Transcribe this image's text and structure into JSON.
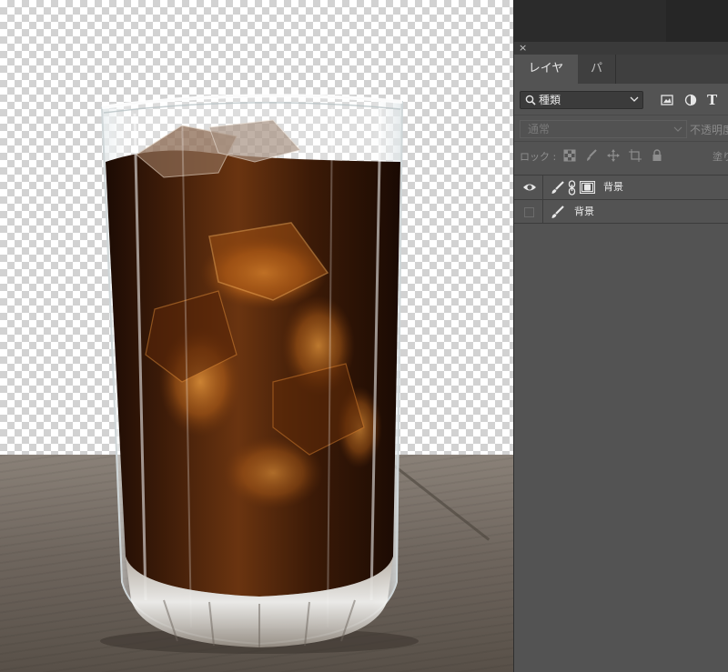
{
  "panel": {
    "close_glyph": "×",
    "tabs": [
      {
        "label": "レイヤー",
        "active": true
      },
      {
        "label": "パス",
        "active": false
      }
    ],
    "filter": {
      "label": "種類",
      "icons": [
        "search-icon",
        "chevron-down-icon",
        "image-filter-icon",
        "adjustment-filter-icon",
        "type-filter-icon"
      ],
      "type_glyph": "T"
    },
    "blend_mode": "通常",
    "opacity_label": "不透明度",
    "lock_label": "ロック :",
    "lock_icons": [
      "lock-transparent-icon",
      "lock-paint-icon",
      "lock-move-icon",
      "lock-artboard-icon",
      "lock-all-icon"
    ],
    "fill_label": "塗り",
    "layers": [
      {
        "name": "背景",
        "visible": true,
        "has_mask": true,
        "icons": [
          "eye-icon",
          "brush-icon",
          "chain-icon",
          "mask-icon"
        ]
      },
      {
        "name": "背景",
        "visible": false,
        "has_mask": false,
        "icons": [
          "brush-icon"
        ]
      }
    ]
  },
  "colors": {
    "panel_bg": "#535353",
    "tab_bar": "#3f3f3f",
    "canvas_dark": "#262626",
    "checker_light": "#ffffff",
    "checker_dark": "#d2d2d2",
    "table_wood": "#7a7168",
    "cola": "#3a1a08",
    "cola_highlight": "#e08a2a"
  }
}
